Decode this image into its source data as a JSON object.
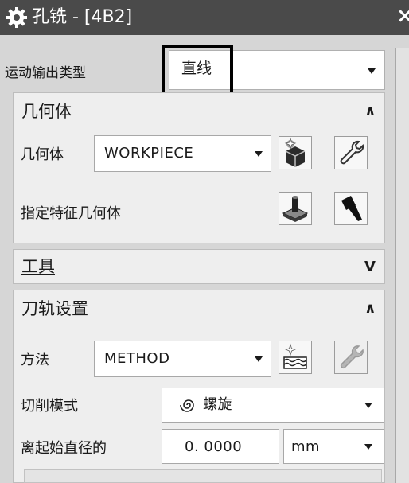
{
  "window": {
    "title": "孔铣 - [4B2]",
    "close_symbol": "×",
    "icons": [
      "gear-icon",
      "close-icon"
    ]
  },
  "motion_output": {
    "label": "运动输出类型",
    "value": "直线",
    "icon": "chevron-down-icon"
  },
  "geometry_section": {
    "title": "几何体",
    "state_icon": "chevron-up-icon",
    "geometry_label": "几何体",
    "geometry_value": "WORKPIECE",
    "feature_label": "指定特征几何体",
    "icons": [
      "new-geometry-icon",
      "edit-wrench-icon",
      "feature-geometry-icon",
      "flashlight-icon"
    ]
  },
  "tools_section": {
    "title": "工具",
    "state_icon": "chevron-down-icon"
  },
  "path_section": {
    "title": "刀轨设置",
    "state_icon": "chevron-up-icon",
    "method_label": "方法",
    "method_value": "METHOD",
    "cut_mode_label": "切削模式",
    "cut_mode_value": "螺旋",
    "start_diameter_label": "离起始直径的",
    "start_diameter_value": "0. 0000",
    "unit_value": "mm",
    "icons": [
      "new-method-icon",
      "edit-wrench-disabled-icon",
      "spiral-icon"
    ]
  },
  "colors": {
    "titlebar": "#4a4a4a",
    "dialog_bg": "#d6d6d6",
    "panel_bg": "#eeeeee",
    "highlight_border": "#000000"
  }
}
